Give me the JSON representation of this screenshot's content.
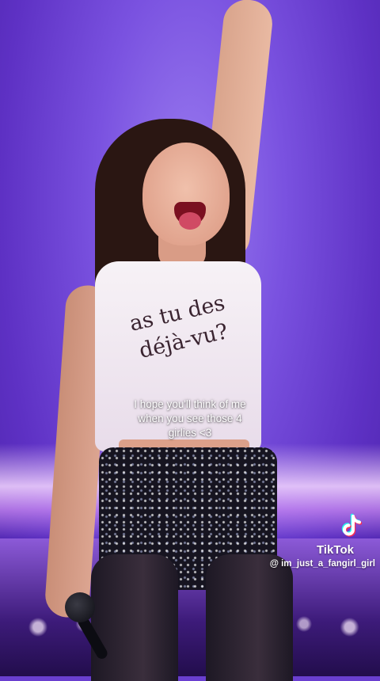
{
  "shirt": {
    "line1": "as tu des",
    "line2": "déjà-vu?"
  },
  "caption": {
    "line1": "I hope you'll think of me",
    "line2": "when you see those 4",
    "line3": "girlies <3"
  },
  "watermark": {
    "brand": "TikTok",
    "username": "@ im_just_a_fangirl_girl",
    "icon": "tiktok-logo-icon"
  },
  "colors": {
    "background": "#6a3fd0",
    "caption_text": "#ffffff",
    "shirt_text": "#3a2430"
  }
}
